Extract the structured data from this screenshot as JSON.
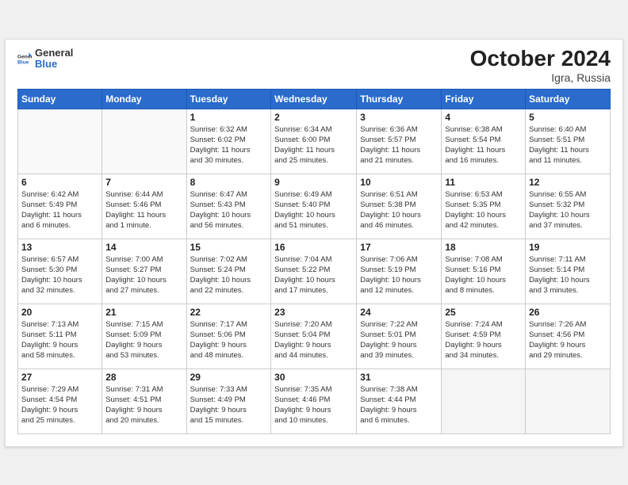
{
  "logo": {
    "text_general": "General",
    "text_blue": "Blue"
  },
  "title": "October 2024",
  "location": "Igra, Russia",
  "weekdays": [
    "Sunday",
    "Monday",
    "Tuesday",
    "Wednesday",
    "Thursday",
    "Friday",
    "Saturday"
  ],
  "rows": [
    [
      {
        "day": "",
        "info": ""
      },
      {
        "day": "",
        "info": ""
      },
      {
        "day": "1",
        "info": "Sunrise: 6:32 AM\nSunset: 6:02 PM\nDaylight: 11 hours\nand 30 minutes."
      },
      {
        "day": "2",
        "info": "Sunrise: 6:34 AM\nSunset: 6:00 PM\nDaylight: 11 hours\nand 25 minutes."
      },
      {
        "day": "3",
        "info": "Sunrise: 6:36 AM\nSunset: 5:57 PM\nDaylight: 11 hours\nand 21 minutes."
      },
      {
        "day": "4",
        "info": "Sunrise: 6:38 AM\nSunset: 5:54 PM\nDaylight: 11 hours\nand 16 minutes."
      },
      {
        "day": "5",
        "info": "Sunrise: 6:40 AM\nSunset: 5:51 PM\nDaylight: 11 hours\nand 11 minutes."
      }
    ],
    [
      {
        "day": "6",
        "info": "Sunrise: 6:42 AM\nSunset: 5:49 PM\nDaylight: 11 hours\nand 6 minutes."
      },
      {
        "day": "7",
        "info": "Sunrise: 6:44 AM\nSunset: 5:46 PM\nDaylight: 11 hours\nand 1 minute."
      },
      {
        "day": "8",
        "info": "Sunrise: 6:47 AM\nSunset: 5:43 PM\nDaylight: 10 hours\nand 56 minutes."
      },
      {
        "day": "9",
        "info": "Sunrise: 6:49 AM\nSunset: 5:40 PM\nDaylight: 10 hours\nand 51 minutes."
      },
      {
        "day": "10",
        "info": "Sunrise: 6:51 AM\nSunset: 5:38 PM\nDaylight: 10 hours\nand 46 minutes."
      },
      {
        "day": "11",
        "info": "Sunrise: 6:53 AM\nSunset: 5:35 PM\nDaylight: 10 hours\nand 42 minutes."
      },
      {
        "day": "12",
        "info": "Sunrise: 6:55 AM\nSunset: 5:32 PM\nDaylight: 10 hours\nand 37 minutes."
      }
    ],
    [
      {
        "day": "13",
        "info": "Sunrise: 6:57 AM\nSunset: 5:30 PM\nDaylight: 10 hours\nand 32 minutes."
      },
      {
        "day": "14",
        "info": "Sunrise: 7:00 AM\nSunset: 5:27 PM\nDaylight: 10 hours\nand 27 minutes."
      },
      {
        "day": "15",
        "info": "Sunrise: 7:02 AM\nSunset: 5:24 PM\nDaylight: 10 hours\nand 22 minutes."
      },
      {
        "day": "16",
        "info": "Sunrise: 7:04 AM\nSunset: 5:22 PM\nDaylight: 10 hours\nand 17 minutes."
      },
      {
        "day": "17",
        "info": "Sunrise: 7:06 AM\nSunset: 5:19 PM\nDaylight: 10 hours\nand 12 minutes."
      },
      {
        "day": "18",
        "info": "Sunrise: 7:08 AM\nSunset: 5:16 PM\nDaylight: 10 hours\nand 8 minutes."
      },
      {
        "day": "19",
        "info": "Sunrise: 7:11 AM\nSunset: 5:14 PM\nDaylight: 10 hours\nand 3 minutes."
      }
    ],
    [
      {
        "day": "20",
        "info": "Sunrise: 7:13 AM\nSunset: 5:11 PM\nDaylight: 9 hours\nand 58 minutes."
      },
      {
        "day": "21",
        "info": "Sunrise: 7:15 AM\nSunset: 5:09 PM\nDaylight: 9 hours\nand 53 minutes."
      },
      {
        "day": "22",
        "info": "Sunrise: 7:17 AM\nSunset: 5:06 PM\nDaylight: 9 hours\nand 48 minutes."
      },
      {
        "day": "23",
        "info": "Sunrise: 7:20 AM\nSunset: 5:04 PM\nDaylight: 9 hours\nand 44 minutes."
      },
      {
        "day": "24",
        "info": "Sunrise: 7:22 AM\nSunset: 5:01 PM\nDaylight: 9 hours\nand 39 minutes."
      },
      {
        "day": "25",
        "info": "Sunrise: 7:24 AM\nSunset: 4:59 PM\nDaylight: 9 hours\nand 34 minutes."
      },
      {
        "day": "26",
        "info": "Sunrise: 7:26 AM\nSunset: 4:56 PM\nDaylight: 9 hours\nand 29 minutes."
      }
    ],
    [
      {
        "day": "27",
        "info": "Sunrise: 7:29 AM\nSunset: 4:54 PM\nDaylight: 9 hours\nand 25 minutes."
      },
      {
        "day": "28",
        "info": "Sunrise: 7:31 AM\nSunset: 4:51 PM\nDaylight: 9 hours\nand 20 minutes."
      },
      {
        "day": "29",
        "info": "Sunrise: 7:33 AM\nSunset: 4:49 PM\nDaylight: 9 hours\nand 15 minutes."
      },
      {
        "day": "30",
        "info": "Sunrise: 7:35 AM\nSunset: 4:46 PM\nDaylight: 9 hours\nand 10 minutes."
      },
      {
        "day": "31",
        "info": "Sunrise: 7:38 AM\nSunset: 4:44 PM\nDaylight: 9 hours\nand 6 minutes."
      },
      {
        "day": "",
        "info": ""
      },
      {
        "day": "",
        "info": ""
      }
    ]
  ]
}
